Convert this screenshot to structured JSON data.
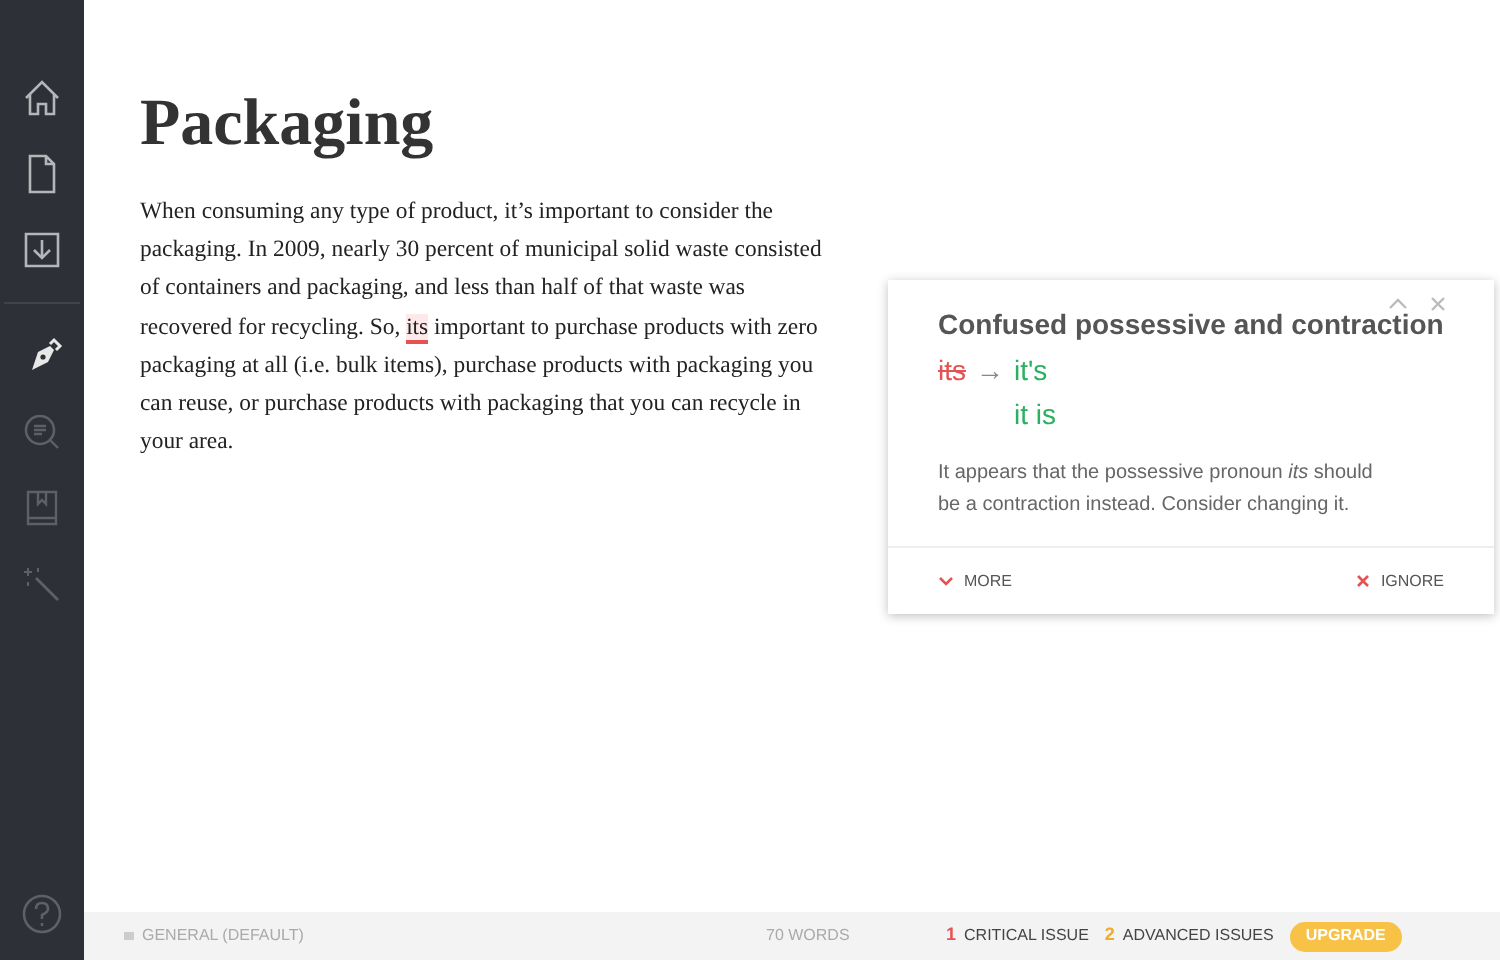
{
  "sidebar": {
    "items": [
      {
        "kind": "home",
        "selected": false
      },
      {
        "kind": "document",
        "selected": false
      },
      {
        "kind": "download",
        "selected": false
      },
      {
        "kind": "pen",
        "selected": true
      },
      {
        "kind": "review",
        "selected": false
      },
      {
        "kind": "book",
        "selected": false
      },
      {
        "kind": "wand",
        "selected": false
      }
    ],
    "help": {
      "kind": "help"
    }
  },
  "document": {
    "title": "Packaging",
    "paragraph": [
      {
        "text": "When consuming any type of product, it’s important to consider the packaging. In 2009, nearly 30 percent of municipal solid waste consisted of containers and packaging, and less than half of that waste was recovered for recycling. So, ",
        "flagged": false
      },
      {
        "text": "its",
        "flagged": true
      },
      {
        "text": " important to purchase products with zero packaging at all (i.e. bulk items), purchase products with packaging you can reuse, or purchase products with packaging that you can recycle in your area.",
        "flagged": false
      }
    ]
  },
  "suggestion_card": {
    "title": "Confused possessive and contraction",
    "mistake": "its",
    "arrow": "→",
    "replacements": [
      "it's",
      "it is"
    ],
    "explanation": "It appears that the possessive pronoun *its* should be a contraction instead. Consider changing it.",
    "more": "MORE",
    "ignore": "IGNORE"
  },
  "status_bar": {
    "genre": "GENERAL (DEFAULT)",
    "word_count": "70 WORDS",
    "critical_count": "1",
    "critical_label": "CRITICAL ISSUE",
    "advanced_count": "2",
    "advanced_label": "ADVANCED ISSUES",
    "upgrade": "UPGRADE"
  }
}
